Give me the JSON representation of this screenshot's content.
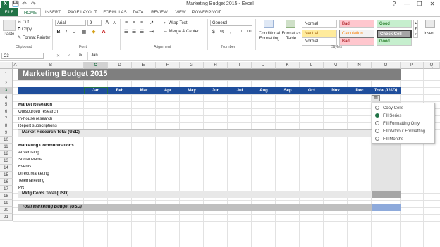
{
  "window": {
    "title": "Marketing Budget 2015 - Excel",
    "minimize": "—",
    "restore": "❐",
    "close": "✕",
    "help": "?"
  },
  "quick_access": {
    "save": "💾",
    "undo": "↶",
    "redo": "↷"
  },
  "tabs": [
    "FILE",
    "HOME",
    "INSERT",
    "PAGE LAYOUT",
    "FORMULAS",
    "DATA",
    "REVIEW",
    "VIEW",
    "POWERPIVOT"
  ],
  "ribbon": {
    "clipboard": {
      "paste": "Paste",
      "cut": "Cut",
      "copy": "Copy",
      "format_painter": "Format Painter",
      "label": "Clipboard"
    },
    "font": {
      "name": "Arial",
      "size": "9",
      "bold": "B",
      "italic": "I",
      "underline": "U",
      "grow": "A",
      "shrink": "A",
      "label": "Font"
    },
    "alignment": {
      "wrap_text": "Wrap Text",
      "merge_center": "Merge & Center",
      "label": "Alignment"
    },
    "number": {
      "format": "General",
      "currency": "$",
      "percent": "%",
      "comma": ",",
      "label": "Number"
    },
    "styles": {
      "conditional_formatting": "Conditional Formatting",
      "format_as_table": "Format as Table",
      "normal": "Normal",
      "bad": "Bad",
      "good": "Good",
      "neutral": "Neutral",
      "calculation": "Calculation",
      "check_cell": "Check Cell",
      "label": "Styles"
    },
    "cells": {
      "insert": "Insert"
    }
  },
  "formula_bar": {
    "name_box": "C3",
    "fx": "fx",
    "cancel": "✕",
    "enter": "✓",
    "content": "Jan"
  },
  "columns": [
    "A",
    "B",
    "C",
    "D",
    "E",
    "F",
    "G",
    "H",
    "I",
    "J",
    "K",
    "L",
    "M",
    "N",
    "O",
    "P",
    "Q"
  ],
  "rows": [
    "1",
    "2",
    "3",
    "4",
    "5",
    "6",
    "7",
    "8",
    "9",
    "10",
    "11",
    "12",
    "13",
    "14",
    "15",
    "16",
    "17",
    "18",
    "19",
    "20",
    "21"
  ],
  "sheet": {
    "title": "Marketing Budget 2015",
    "months": [
      "Jan",
      "Feb",
      "Mar",
      "Apr",
      "May",
      "Jun",
      "Jul",
      "Aug",
      "Sep",
      "Oct",
      "Nov",
      "Dec"
    ],
    "total_header": "Total (USD)",
    "market_research": "Market Research",
    "mr_items": [
      "Outsourced research",
      "In-house research",
      "Report subscriptions"
    ],
    "mr_total": "Market Research Total (USD)",
    "marketing_comms": "Marketing Communications",
    "mc_items": [
      "Advertising",
      "Social Media",
      "Events",
      "Direct Marketing",
      "Telemarketing",
      "PR"
    ],
    "mc_total": "Mktg Coms Total (USD)",
    "grand_total": "Total Marketing Budget (USD)"
  },
  "autofill_menu": {
    "options": [
      "Copy Cells",
      "Fill Series",
      "Fill Formatting Only",
      "Fill Without Formatting",
      "Fill Months"
    ],
    "selected_index": 1
  },
  "colors": {
    "excel_green": "#217346",
    "title_band": "#7f7f7f",
    "header_band": "#1f4e9c",
    "subtotal": "#e8e8e8",
    "total_col": "#d9d9d9",
    "grand_total_cell": "#8eaadb"
  }
}
